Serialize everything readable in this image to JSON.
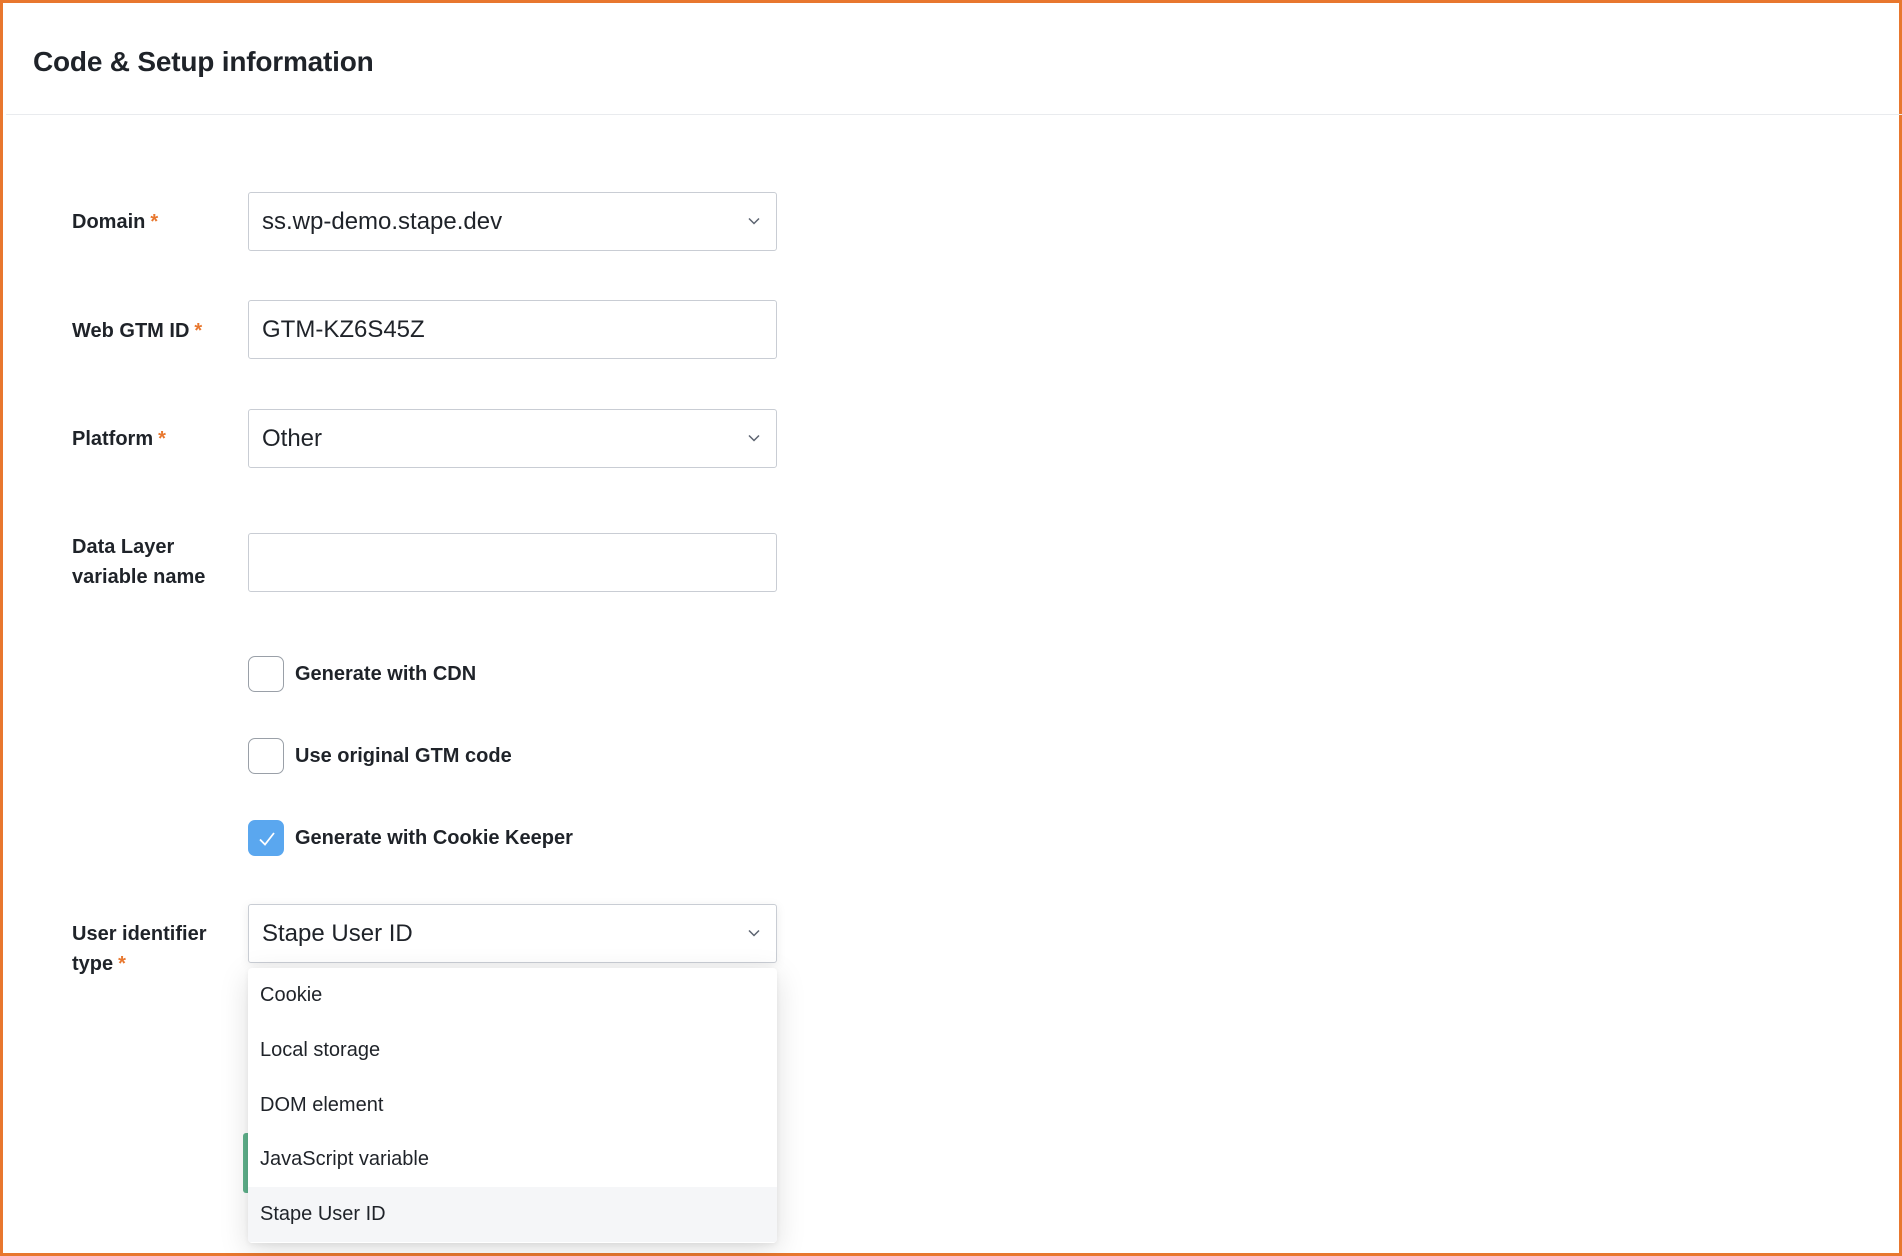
{
  "panel": {
    "title": "Code & Setup information"
  },
  "fields": {
    "domain": {
      "label": "Domain",
      "required_mark": "*",
      "value": "ss.wp-demo.stape.dev"
    },
    "web_gtm_id": {
      "label": "Web GTM ID",
      "required_mark": "*",
      "value": "GTM-KZ6S45Z"
    },
    "platform": {
      "label": "Platform",
      "required_mark": "*",
      "value": "Other"
    },
    "data_layer": {
      "label_line1": "Data Layer",
      "label_line2": "variable name",
      "value": ""
    },
    "user_identifier": {
      "label_line1": "User identifier",
      "label_line2": "type",
      "required_mark": "*",
      "value": "Stape User ID"
    }
  },
  "checkboxes": {
    "cdn": {
      "label": "Generate with CDN",
      "checked": false
    },
    "original_gtm": {
      "label": "Use original GTM code",
      "checked": false
    },
    "cookie_keeper": {
      "label": "Generate with Cookie Keeper",
      "checked": true
    }
  },
  "dropdown": {
    "options": [
      "Cookie",
      "Local storage",
      "DOM element",
      "JavaScript variable",
      "Stape User ID"
    ],
    "selected": "Stape User ID"
  },
  "colors": {
    "accent_orange": "#e8772e",
    "checkbox_blue": "#5aa7ef",
    "button_green": "#5fb28c"
  },
  "icons": {
    "chevron": "chevron-down-icon",
    "check": "check-icon"
  }
}
